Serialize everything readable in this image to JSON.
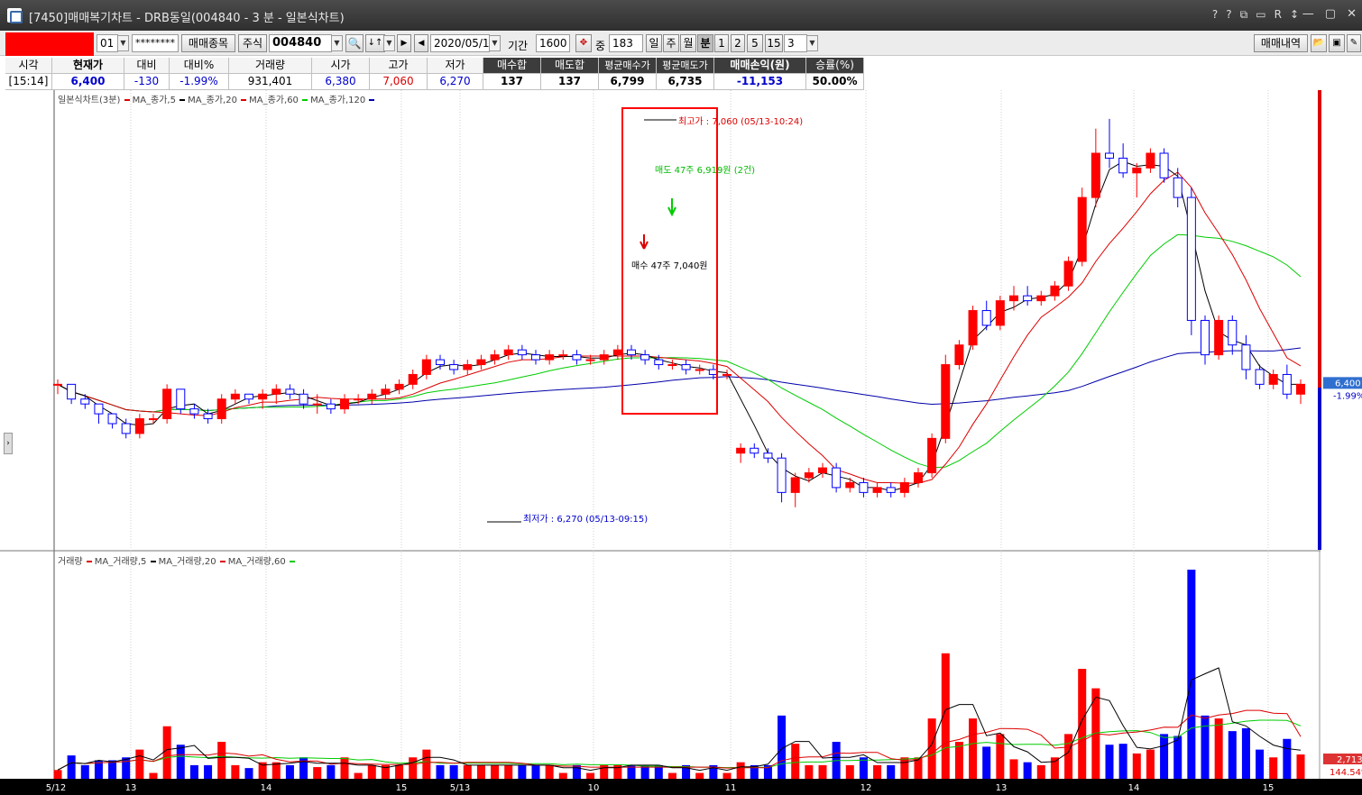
{
  "window": {
    "title": "[7450]매매복기차트 - DRB동일(004840 - 3 분 - 일본식차트)",
    "tools": [
      "?",
      "?",
      "⧉",
      "▭",
      "R",
      "↕"
    ],
    "win_buttons": [
      "—",
      "▢",
      "✕"
    ]
  },
  "toolbar": {
    "account_code": "01",
    "password_mask": "********",
    "trade_item_label": "매매종목",
    "market_label": "주식",
    "stock_code": "004840",
    "date": "2020/05/13",
    "period_label": "기간",
    "period_value": "1600",
    "count_label": "중",
    "count_value": "183",
    "day_label": "일",
    "week_label": "주",
    "month_label": "월",
    "minute_label": "분",
    "minute_options": [
      "1",
      "2",
      "5",
      "15"
    ],
    "minute_value": "3",
    "history_label": "매매내역"
  },
  "info": {
    "headers": {
      "time": "시각",
      "current": "현재가",
      "change": "대비",
      "change_pct": "대비%",
      "volume": "거래량",
      "open": "시가",
      "high": "고가",
      "low": "저가",
      "buy_total": "매수합",
      "sell_total": "매도합",
      "avg_buy": "평균매수가",
      "avg_sell": "평균매도가",
      "pnl": "매매손익(원)",
      "win_rate": "승률(%)"
    },
    "values": {
      "time": "[15:14]",
      "current": "6,400",
      "change": "-130",
      "change_pct": "-1.99%",
      "volume": "931,401",
      "open": "6,380",
      "high": "7,060",
      "low": "6,270",
      "buy_total": "137",
      "sell_total": "137",
      "avg_buy": "6,799",
      "avg_sell": "6,735",
      "pnl": "-11,153",
      "win_rate": "50.00%"
    }
  },
  "price_legend": "일본식차트(3분)",
  "volume_legend": "거래량",
  "colors": {
    "up": "#ff0000",
    "down": "#0000ff",
    "ma5": "#000000",
    "ma20": "#dd0000",
    "ma60": "#00cc00",
    "ma120": "#0000aa"
  },
  "chart_data": {
    "type": "candlestick",
    "title": "일본식차트(3분)",
    "series_names": [
      "MA_종가,5",
      "MA_종가,20",
      "MA_종가,60",
      "MA_종가,120"
    ],
    "volume_series_names": [
      "MA_거래량,5",
      "MA_거래량,20",
      "MA_거래량,60"
    ],
    "x_ticks": [
      "5/12",
      "13",
      "14",
      "15",
      "5/13",
      "10",
      "11",
      "12",
      "13",
      "14",
      "15"
    ],
    "current_price_label": "6,400",
    "current_change_label": "-1.99%",
    "volume_right_labels": [
      "2,713",
      "144.54%"
    ],
    "high_annotation": "최고가 : 7,060 (05/13-10:24)",
    "low_annotation": "최저가 : 6,270 (05/13-09:15)",
    "buy_marker": "매수 47주 7,040원",
    "sell_marker": "매도 47주 6,919원 (2건)",
    "ylim": [
      6220,
      7100
    ],
    "candles": [
      [
        6520,
        6530,
        6500,
        6520
      ],
      [
        6520,
        6510,
        6480,
        6490
      ],
      [
        6490,
        6500,
        6470,
        6480
      ],
      [
        6480,
        6470,
        6440,
        6460
      ],
      [
        6460,
        6460,
        6430,
        6440
      ],
      [
        6440,
        6450,
        6410,
        6420
      ],
      [
        6420,
        6460,
        6410,
        6450
      ],
      [
        6450,
        6460,
        6440,
        6450
      ],
      [
        6450,
        6520,
        6440,
        6510
      ],
      [
        6510,
        6510,
        6460,
        6470
      ],
      [
        6470,
        6480,
        6450,
        6460
      ],
      [
        6460,
        6470,
        6440,
        6450
      ],
      [
        6450,
        6500,
        6440,
        6490
      ],
      [
        6490,
        6510,
        6480,
        6500
      ],
      [
        6500,
        6500,
        6480,
        6490
      ],
      [
        6490,
        6510,
        6470,
        6500
      ],
      [
        6500,
        6520,
        6480,
        6510
      ],
      [
        6510,
        6520,
        6490,
        6500
      ],
      [
        6500,
        6510,
        6470,
        6480
      ],
      [
        6480,
        6500,
        6460,
        6480
      ],
      [
        6480,
        6490,
        6460,
        6470
      ],
      [
        6470,
        6500,
        6460,
        6490
      ],
      [
        6490,
        6500,
        6480,
        6490
      ],
      [
        6490,
        6510,
        6480,
        6500
      ],
      [
        6500,
        6520,
        6490,
        6510
      ],
      [
        6510,
        6530,
        6500,
        6520
      ],
      [
        6520,
        6550,
        6510,
        6540
      ],
      [
        6540,
        6580,
        6530,
        6570
      ],
      [
        6570,
        6580,
        6550,
        6560
      ],
      [
        6560,
        6570,
        6540,
        6550
      ],
      [
        6550,
        6570,
        6540,
        6560
      ],
      [
        6560,
        6580,
        6550,
        6570
      ],
      [
        6570,
        6590,
        6560,
        6580
      ],
      [
        6580,
        6600,
        6570,
        6590
      ],
      [
        6590,
        6600,
        6570,
        6580
      ],
      [
        6580,
        6590,
        6560,
        6570
      ],
      [
        6570,
        6590,
        6560,
        6580
      ],
      [
        6580,
        6590,
        6570,
        6580
      ],
      [
        6580,
        6590,
        6560,
        6570
      ],
      [
        6570,
        6580,
        6560,
        6570
      ],
      [
        6570,
        6590,
        6560,
        6580
      ],
      [
        6580,
        6600,
        6570,
        6590
      ],
      [
        6590,
        6600,
        6570,
        6580
      ],
      [
        6580,
        6590,
        6560,
        6570
      ],
      [
        6570,
        6580,
        6550,
        6560
      ],
      [
        6560,
        6570,
        6550,
        6560
      ],
      [
        6560,
        6570,
        6540,
        6550
      ],
      [
        6550,
        6560,
        6540,
        6550
      ],
      [
        6550,
        6560,
        6530,
        6540
      ],
      [
        6540,
        6550,
        6530,
        6540
      ],
      [
        6380,
        6400,
        6360,
        6390
      ],
      [
        6390,
        6400,
        6370,
        6380
      ],
      [
        6380,
        6390,
        6360,
        6370
      ],
      [
        6370,
        6380,
        6280,
        6300
      ],
      [
        6300,
        6340,
        6270,
        6330
      ],
      [
        6330,
        6350,
        6320,
        6340
      ],
      [
        6340,
        6360,
        6330,
        6350
      ],
      [
        6350,
        6360,
        6300,
        6310
      ],
      [
        6310,
        6330,
        6300,
        6320
      ],
      [
        6320,
        6330,
        6290,
        6300
      ],
      [
        6300,
        6320,
        6290,
        6310
      ],
      [
        6310,
        6320,
        6290,
        6300
      ],
      [
        6300,
        6330,
        6290,
        6320
      ],
      [
        6320,
        6350,
        6310,
        6340
      ],
      [
        6340,
        6420,
        6330,
        6410
      ],
      [
        6410,
        6580,
        6400,
        6560
      ],
      [
        6560,
        6610,
        6550,
        6600
      ],
      [
        6600,
        6680,
        6590,
        6670
      ],
      [
        6670,
        6690,
        6630,
        6640
      ],
      [
        6640,
        6700,
        6630,
        6690
      ],
      [
        6690,
        6720,
        6670,
        6700
      ],
      [
        6700,
        6720,
        6680,
        6690
      ],
      [
        6690,
        6710,
        6680,
        6700
      ],
      [
        6700,
        6730,
        6690,
        6720
      ],
      [
        6720,
        6780,
        6710,
        6770
      ],
      [
        6770,
        6920,
        6760,
        6900
      ],
      [
        6900,
        7040,
        6880,
        6990
      ],
      [
        6990,
        7060,
        6960,
        6980
      ],
      [
        6980,
        7010,
        6940,
        6950
      ],
      [
        6950,
        6970,
        6900,
        6960
      ],
      [
        6960,
        7000,
        6950,
        6990
      ],
      [
        6990,
        7000,
        6930,
        6940
      ],
      [
        6940,
        6960,
        6880,
        6900
      ],
      [
        6900,
        6920,
        6620,
        6650
      ],
      [
        6650,
        6660,
        6560,
        6580
      ],
      [
        6580,
        6660,
        6570,
        6650
      ],
      [
        6650,
        6660,
        6580,
        6600
      ],
      [
        6600,
        6620,
        6530,
        6550
      ],
      [
        6550,
        6560,
        6510,
        6520
      ],
      [
        6520,
        6550,
        6510,
        6540
      ],
      [
        6540,
        6560,
        6490,
        6500
      ],
      [
        6500,
        6530,
        6480,
        6520
      ]
    ]
  }
}
